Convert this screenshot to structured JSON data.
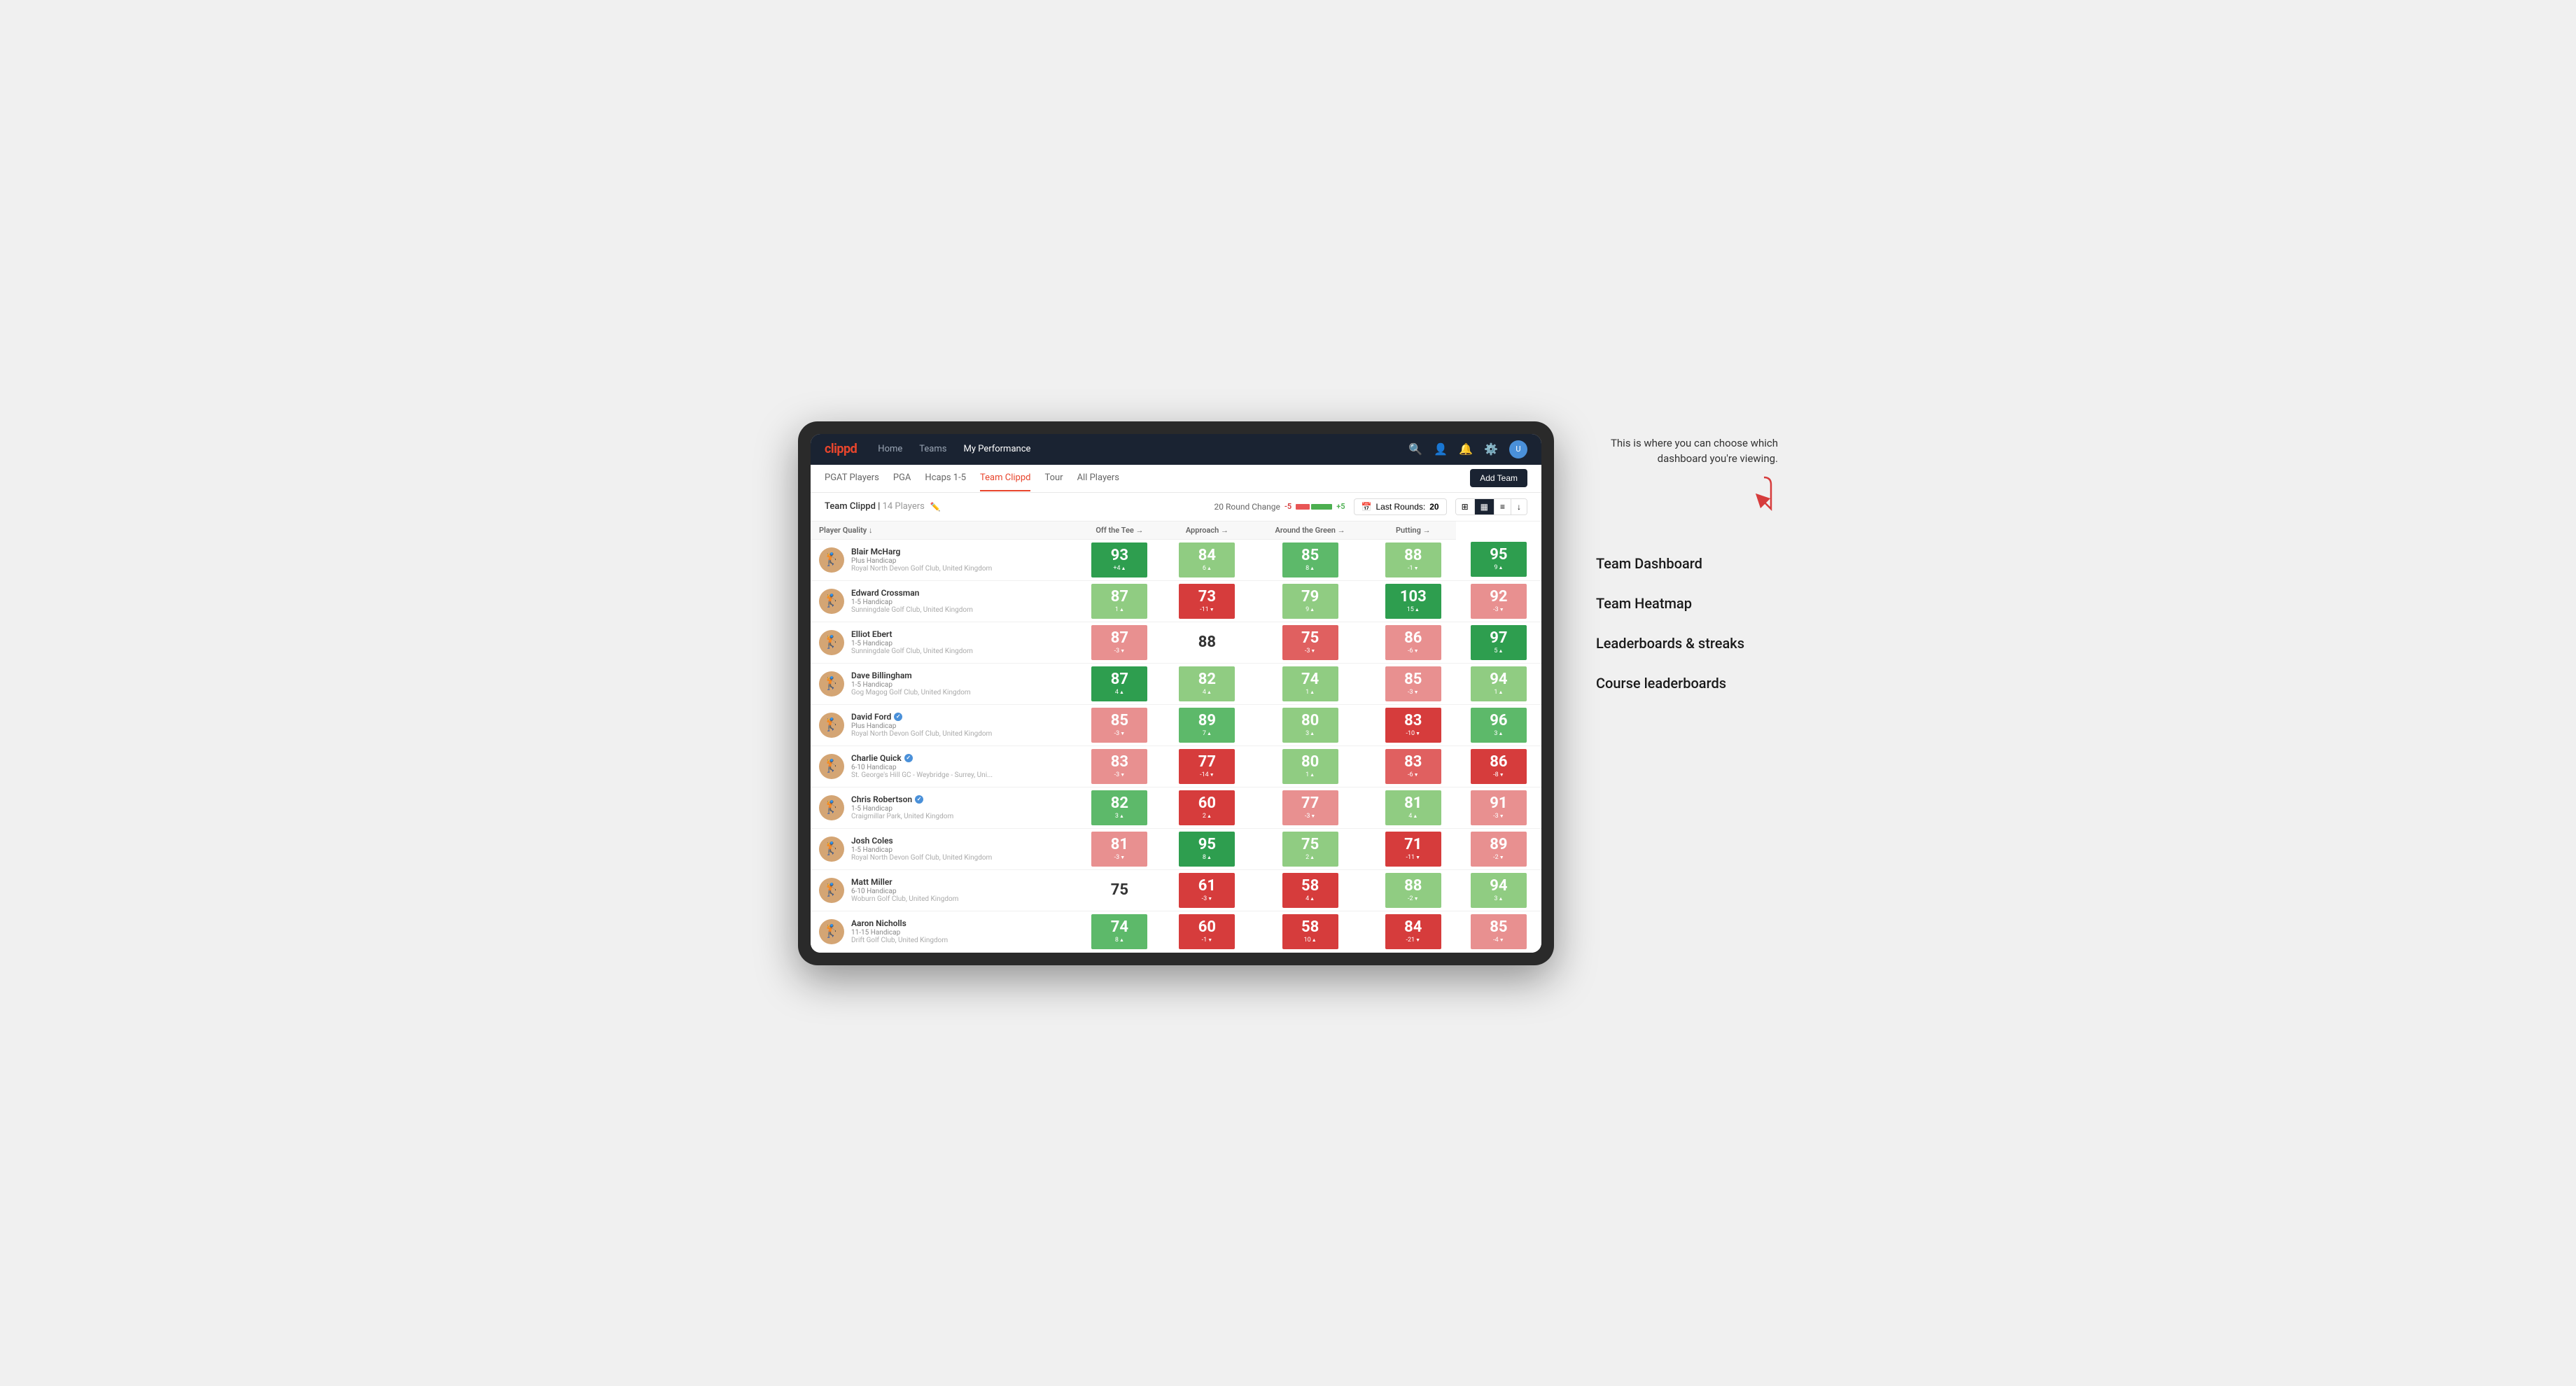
{
  "annotation": {
    "intro_text": "This is where you can choose which dashboard you're viewing.",
    "items": [
      "Team Dashboard",
      "Team Heatmap",
      "Leaderboards & streaks",
      "Course leaderboards"
    ]
  },
  "nav": {
    "logo": "clippd",
    "links": [
      "Home",
      "Teams",
      "My Performance"
    ],
    "active_link": "My Performance"
  },
  "sub_nav": {
    "links": [
      "PGAT Players",
      "PGA",
      "Hcaps 1-5",
      "Team Clippd",
      "Tour",
      "All Players"
    ],
    "active": "Team Clippd",
    "add_button": "Add Team"
  },
  "team_header": {
    "title": "Team Clippd",
    "player_count": "14 Players",
    "round_change_label": "20 Round Change",
    "round_minus": "-5",
    "round_plus": "+5",
    "last_rounds_label": "Last Rounds:",
    "last_rounds_value": "20"
  },
  "table": {
    "columns": [
      "Player Quality ↓",
      "Off the Tee →",
      "Approach →",
      "Around the Green →",
      "Putting →"
    ],
    "players": [
      {
        "name": "Blair McHarg",
        "handicap": "Plus Handicap",
        "club": "Royal North Devon Golf Club, United Kingdom",
        "verified": false,
        "scores": [
          {
            "value": 93,
            "change": "+4",
            "dir": "up",
            "color": "bg-green-dark"
          },
          {
            "value": 84,
            "change": "6",
            "dir": "up",
            "color": "bg-green-light"
          },
          {
            "value": 85,
            "change": "8",
            "dir": "up",
            "color": "bg-green-med"
          },
          {
            "value": 88,
            "change": "-1",
            "dir": "down",
            "color": "bg-green-light"
          },
          {
            "value": 95,
            "change": "9",
            "dir": "up",
            "color": "bg-green-dark"
          }
        ]
      },
      {
        "name": "Edward Crossman",
        "handicap": "1-5 Handicap",
        "club": "Sunningdale Golf Club, United Kingdom",
        "verified": false,
        "scores": [
          {
            "value": 87,
            "change": "1",
            "dir": "up",
            "color": "bg-green-light"
          },
          {
            "value": 73,
            "change": "-11",
            "dir": "down",
            "color": "bg-red-dark"
          },
          {
            "value": 79,
            "change": "9",
            "dir": "up",
            "color": "bg-green-light"
          },
          {
            "value": 103,
            "change": "15",
            "dir": "up",
            "color": "bg-green-dark"
          },
          {
            "value": 92,
            "change": "-3",
            "dir": "down",
            "color": "bg-red-light"
          }
        ]
      },
      {
        "name": "Elliot Ebert",
        "handicap": "1-5 Handicap",
        "club": "Sunningdale Golf Club, United Kingdom",
        "verified": false,
        "scores": [
          {
            "value": 87,
            "change": "-3",
            "dir": "down",
            "color": "bg-red-light"
          },
          {
            "value": 88,
            "change": "",
            "dir": "",
            "color": "bg-white"
          },
          {
            "value": 75,
            "change": "-3",
            "dir": "down",
            "color": "bg-red-med"
          },
          {
            "value": 86,
            "change": "-6",
            "dir": "down",
            "color": "bg-red-light"
          },
          {
            "value": 97,
            "change": "5",
            "dir": "up",
            "color": "bg-green-dark"
          }
        ]
      },
      {
        "name": "Dave Billingham",
        "handicap": "1-5 Handicap",
        "club": "Gog Magog Golf Club, United Kingdom",
        "verified": false,
        "scores": [
          {
            "value": 87,
            "change": "4",
            "dir": "up",
            "color": "bg-green-dark"
          },
          {
            "value": 82,
            "change": "4",
            "dir": "up",
            "color": "bg-green-light"
          },
          {
            "value": 74,
            "change": "1",
            "dir": "up",
            "color": "bg-green-light"
          },
          {
            "value": 85,
            "change": "-3",
            "dir": "down",
            "color": "bg-red-light"
          },
          {
            "value": 94,
            "change": "1",
            "dir": "up",
            "color": "bg-green-light"
          }
        ]
      },
      {
        "name": "David Ford",
        "handicap": "Plus Handicap",
        "club": "Royal North Devon Golf Club, United Kingdom",
        "verified": true,
        "scores": [
          {
            "value": 85,
            "change": "-3",
            "dir": "down",
            "color": "bg-red-light"
          },
          {
            "value": 89,
            "change": "7",
            "dir": "up",
            "color": "bg-green-med"
          },
          {
            "value": 80,
            "change": "3",
            "dir": "up",
            "color": "bg-green-light"
          },
          {
            "value": 83,
            "change": "-10",
            "dir": "down",
            "color": "bg-red-dark"
          },
          {
            "value": 96,
            "change": "3",
            "dir": "up",
            "color": "bg-green-med"
          }
        ]
      },
      {
        "name": "Charlie Quick",
        "handicap": "6-10 Handicap",
        "club": "St. George's Hill GC - Weybridge - Surrey, Uni...",
        "verified": true,
        "scores": [
          {
            "value": 83,
            "change": "-3",
            "dir": "down",
            "color": "bg-red-light"
          },
          {
            "value": 77,
            "change": "-14",
            "dir": "down",
            "color": "bg-red-dark"
          },
          {
            "value": 80,
            "change": "1",
            "dir": "up",
            "color": "bg-green-light"
          },
          {
            "value": 83,
            "change": "-6",
            "dir": "down",
            "color": "bg-red-med"
          },
          {
            "value": 86,
            "change": "-8",
            "dir": "down",
            "color": "bg-red-dark"
          }
        ]
      },
      {
        "name": "Chris Robertson",
        "handicap": "1-5 Handicap",
        "club": "Craigmillar Park, United Kingdom",
        "verified": true,
        "scores": [
          {
            "value": 82,
            "change": "3",
            "dir": "up",
            "color": "bg-green-med"
          },
          {
            "value": 60,
            "change": "2",
            "dir": "up",
            "color": "bg-red-dark"
          },
          {
            "value": 77,
            "change": "-3",
            "dir": "down",
            "color": "bg-red-light"
          },
          {
            "value": 81,
            "change": "4",
            "dir": "up",
            "color": "bg-green-light"
          },
          {
            "value": 91,
            "change": "-3",
            "dir": "down",
            "color": "bg-red-light"
          }
        ]
      },
      {
        "name": "Josh Coles",
        "handicap": "1-5 Handicap",
        "club": "Royal North Devon Golf Club, United Kingdom",
        "verified": false,
        "scores": [
          {
            "value": 81,
            "change": "-3",
            "dir": "down",
            "color": "bg-red-light"
          },
          {
            "value": 95,
            "change": "8",
            "dir": "up",
            "color": "bg-green-dark"
          },
          {
            "value": 75,
            "change": "2",
            "dir": "up",
            "color": "bg-green-light"
          },
          {
            "value": 71,
            "change": "-11",
            "dir": "down",
            "color": "bg-red-dark"
          },
          {
            "value": 89,
            "change": "-2",
            "dir": "down",
            "color": "bg-red-light"
          }
        ]
      },
      {
        "name": "Matt Miller",
        "handicap": "6-10 Handicap",
        "club": "Woburn Golf Club, United Kingdom",
        "verified": false,
        "scores": [
          {
            "value": 75,
            "change": "",
            "dir": "",
            "color": "bg-white"
          },
          {
            "value": 61,
            "change": "-3",
            "dir": "down",
            "color": "bg-red-dark"
          },
          {
            "value": 58,
            "change": "4",
            "dir": "up",
            "color": "bg-red-dark"
          },
          {
            "value": 88,
            "change": "-2",
            "dir": "down",
            "color": "bg-green-light"
          },
          {
            "value": 94,
            "change": "3",
            "dir": "up",
            "color": "bg-green-light"
          }
        ]
      },
      {
        "name": "Aaron Nicholls",
        "handicap": "11-15 Handicap",
        "club": "Drift Golf Club, United Kingdom",
        "verified": false,
        "scores": [
          {
            "value": 74,
            "change": "8",
            "dir": "up",
            "color": "bg-green-med"
          },
          {
            "value": 60,
            "change": "-1",
            "dir": "down",
            "color": "bg-red-dark"
          },
          {
            "value": 58,
            "change": "10",
            "dir": "up",
            "color": "bg-red-dark"
          },
          {
            "value": 84,
            "change": "-21",
            "dir": "down",
            "color": "bg-red-dark"
          },
          {
            "value": 85,
            "change": "-4",
            "dir": "down",
            "color": "bg-red-light"
          }
        ]
      }
    ]
  },
  "avatars": [
    "👤",
    "👤",
    "👤",
    "👤",
    "👤",
    "👤",
    "👤",
    "👤",
    "👤",
    "👤"
  ]
}
